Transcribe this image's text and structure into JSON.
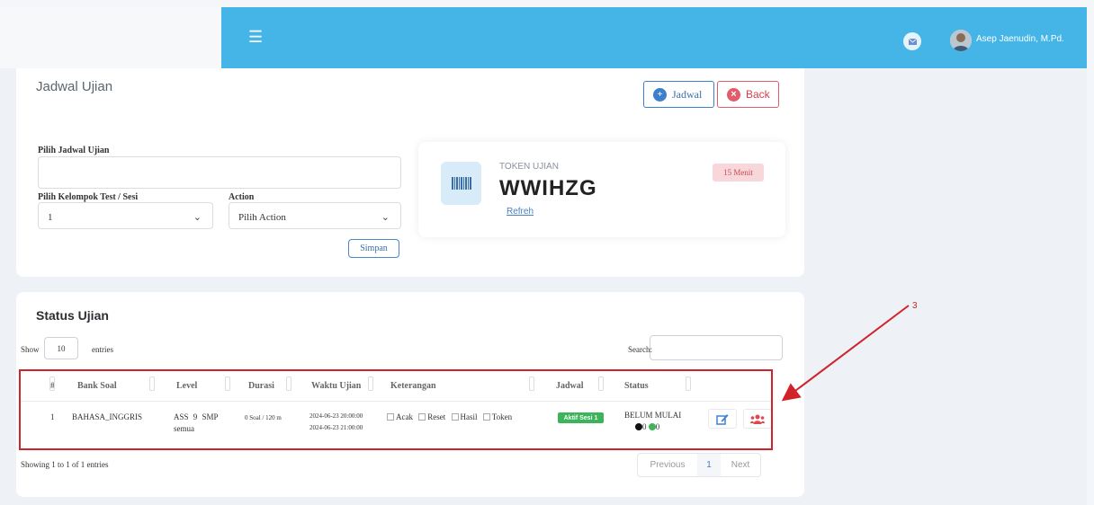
{
  "header": {
    "menu_icon": "hamburger-icon",
    "mail_icon": "envelope-icon",
    "user_name": "Asep Jaenudin, M.Pd.",
    "accent": "#45b5e8"
  },
  "jadwal": {
    "title": "Jadwal Ujian",
    "btn_jadwal": "Jadwal",
    "btn_back": "Back",
    "pilih_jadwal_label": "Pilih Jadwal Ujian",
    "pilih_jadwal_value": "",
    "kelompok_label": "Pilih Kelompok Test / Sesi",
    "kelompok_value": "1",
    "action_label": "Action",
    "action_value": "Pilih Action",
    "simpan": "Simpan"
  },
  "token": {
    "label": "TOKEN UJIAN",
    "value": "WWIHZG",
    "refresh": "Refreh",
    "badge": "15 Menit"
  },
  "status": {
    "title": "Status Ujian",
    "show": "Show",
    "entries_value": "10",
    "entries": "entries",
    "search": "Search:",
    "headers": [
      "#",
      "Bank Soal",
      "Level",
      "Durasi",
      "Waktu Ujian",
      "Keterangan",
      "Jadwal",
      "Status"
    ],
    "row": {
      "no": "1",
      "bank_soal": "BAHASA_INGGRIS",
      "level_line1": "ASS 9 SMP",
      "level_line2": "semua",
      "durasi": "0 Soal / 120 m",
      "waktu1": "2024-06-23 20:00:00",
      "waktu2": "2024-06-23 21:00:00",
      "ket": [
        "Acak",
        "Reset",
        "Hasil",
        "Token"
      ],
      "jadwal_badge": "Aktif Sesi 1",
      "status_text": "BELUM MULAI",
      "count_black": "0",
      "count_green": "0"
    },
    "showing": "Showing 1 to 1 of 1 entries",
    "prev": "Previous",
    "page": "1",
    "next": "Next"
  },
  "annotation": {
    "number": "3",
    "color": "#d0232a"
  }
}
